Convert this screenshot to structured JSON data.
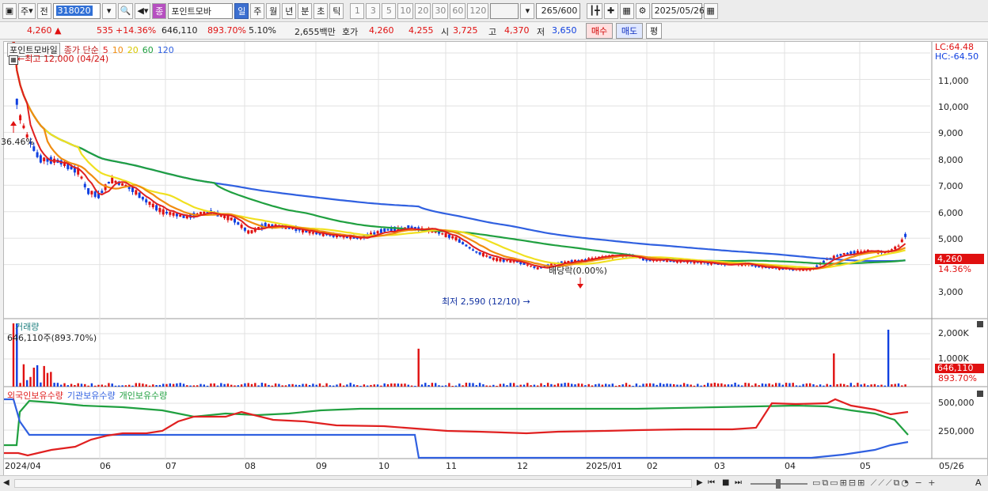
{
  "toolbar": {
    "market": "주",
    "prev": "전",
    "code": "318020",
    "name": "포인트모바",
    "name_badge": "종",
    "periods": [
      "일",
      "주",
      "월",
      "년",
      "분",
      "초",
      "틱"
    ],
    "active_period": "일",
    "intervals": [
      "1",
      "3",
      "5",
      "10",
      "20",
      "30",
      "60",
      "120"
    ],
    "count": "265",
    "count_total": "/600",
    "date": "2025/05/26"
  },
  "infobar": {
    "price": "4,260",
    "change": "535",
    "change_pct": "+14.36%",
    "volume": "646,110",
    "volume_pct": "893.70%",
    "turnover_pct": "5.10%",
    "amount": "2,655백만",
    "hoga_label": "호가",
    "hoga_ask": "4,260",
    "hoga_bid": "4,255",
    "open_label": "시",
    "open": "3,725",
    "high_label": "고",
    "high": "4,370",
    "low_label": "저",
    "low": "3,650",
    "buy": "매수",
    "sell": "매도",
    "avg": "평"
  },
  "price_panel": {
    "stock_label": "포인트모바일",
    "ma_label": "종가 단순",
    "ma_periods": [
      {
        "label": "5",
        "color": "#e02020"
      },
      {
        "label": "10",
        "color": "#f08c10"
      },
      {
        "label": "20",
        "color": "#f0e020"
      },
      {
        "label": "60",
        "color": "#20a040"
      },
      {
        "label": "120",
        "color": "#3060e0"
      }
    ],
    "lc": "LC:64.48",
    "hc": "HC:-64.50",
    "high_note": "←최고 12,000 (04/24)",
    "low_note": "최저 2,590 (12/10) →",
    "pct_note": "36.46%",
    "dividend_note": "배당락(0.00%)",
    "y_ticks": [
      "11,000",
      "10,000",
      "9,000",
      "8,000",
      "7,000",
      "6,000",
      "5,000",
      "3,000"
    ],
    "cur_price": "4,260",
    "cur_pct": "14.36%"
  },
  "volume_panel": {
    "title": "거래량",
    "value": "646,110주(893.70%)",
    "y_ticks": [
      "2,000K",
      "1,000K"
    ],
    "cur_value": "646,110",
    "cur_pct": "893.70%"
  },
  "holdings_panel": {
    "series": [
      {
        "label": "외국인보유수량",
        "color": "#e02020"
      },
      {
        "label": "기관보유수량",
        "color": "#3060e0"
      },
      {
        "label": "개인보유수량",
        "color": "#20a040"
      }
    ],
    "y_ticks": [
      "500,000",
      "250,000"
    ]
  },
  "x_axis": {
    "labels": [
      "2024/04",
      "06",
      "07",
      "08",
      "09",
      "10",
      "11",
      "12",
      "2025/01",
      "02",
      "03",
      "04",
      "05"
    ],
    "end_label": "05/26"
  },
  "colors": {
    "up": "#e01010",
    "down": "#1040e0",
    "ma5": "#e02020",
    "ma10": "#f08c10",
    "ma20": "#f0e020",
    "ma60": "#20a040",
    "ma120": "#3060e0"
  }
}
